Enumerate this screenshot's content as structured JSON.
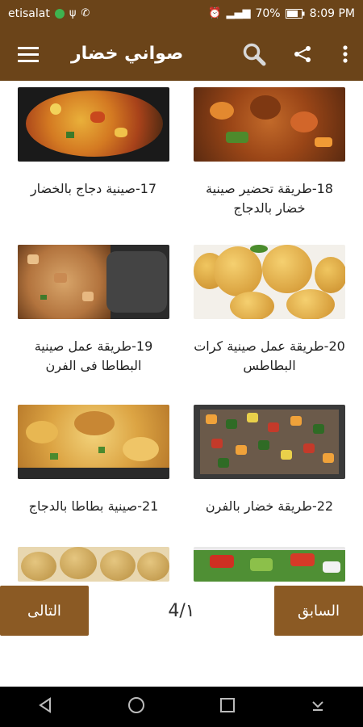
{
  "status_bar": {
    "carrier": "etisalat",
    "battery": "70%",
    "time": "8:09 PM"
  },
  "app_bar": {
    "title": "صواني خضار"
  },
  "recipes": [
    {
      "caption": "17-صينية دجاج بالخضار"
    },
    {
      "caption": "18-طريقة تحضير صينية خضار بالدجاج"
    },
    {
      "caption": "19-طريقة عمل صينية البطاطا فى الفرن"
    },
    {
      "caption": "20-طريقة عمل صينية كرات البطاطس"
    },
    {
      "caption": "21-صينية بطاطا بالدجاج"
    },
    {
      "caption": "22-طريقة خضار بالفرن"
    }
  ],
  "pagination": {
    "next_label": "التالى",
    "prev_label": "السابق",
    "page_indicator": "4/١"
  },
  "colors": {
    "app_bar": "#6b4419",
    "button": "#8b5a24"
  }
}
